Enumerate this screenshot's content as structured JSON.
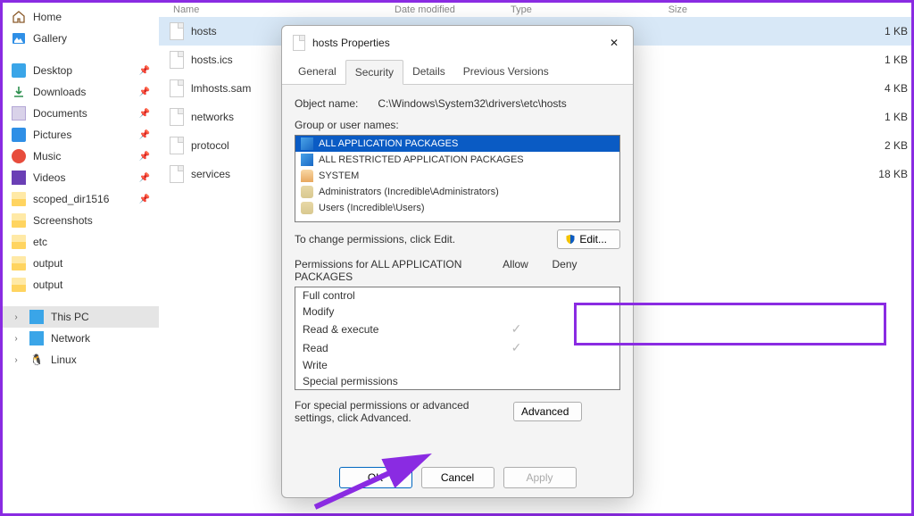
{
  "sidebar": {
    "home": "Home",
    "gallery": "Gallery",
    "quick": [
      {
        "label": "Desktop"
      },
      {
        "label": "Downloads"
      },
      {
        "label": "Documents"
      },
      {
        "label": "Pictures"
      },
      {
        "label": "Music"
      },
      {
        "label": "Videos"
      },
      {
        "label": "scoped_dir1516"
      },
      {
        "label": "Screenshots"
      },
      {
        "label": "etc"
      },
      {
        "label": "output"
      },
      {
        "label": "output"
      }
    ],
    "this_pc": "This PC",
    "network": "Network",
    "linux": "Linux"
  },
  "columns": {
    "name": "Name",
    "date": "Date modified",
    "type": "Type",
    "size": "Size"
  },
  "files": [
    {
      "name": "hosts",
      "size": "1 KB",
      "selected": true
    },
    {
      "name": "hosts.ics",
      "size": "1 KB"
    },
    {
      "name": "lmhosts.sam",
      "size": "4 KB"
    },
    {
      "name": "networks",
      "size": "1 KB"
    },
    {
      "name": "protocol",
      "size": "2 KB"
    },
    {
      "name": "services",
      "size": "18 KB"
    }
  ],
  "dialog": {
    "title": "hosts Properties",
    "tabs": [
      "General",
      "Security",
      "Details",
      "Previous Versions"
    ],
    "active_tab": "Security",
    "object_label": "Object name:",
    "object_path": "C:\\Windows\\System32\\drivers\\etc\\hosts",
    "groups_label": "Group or user names:",
    "groups": [
      {
        "label": "ALL APPLICATION PACKAGES",
        "icon": "pkg",
        "selected": true
      },
      {
        "label": "ALL RESTRICTED APPLICATION PACKAGES",
        "icon": "pkg"
      },
      {
        "label": "SYSTEM",
        "icon": "sys"
      },
      {
        "label": "Administrators (Incredible\\Administrators)",
        "icon": "users"
      },
      {
        "label": "Users (Incredible\\Users)",
        "icon": "users"
      }
    ],
    "change_text": "To change permissions, click Edit.",
    "edit_btn": "Edit...",
    "perm_for": "Permissions for ALL APPLICATION PACKAGES",
    "allow": "Allow",
    "deny": "Deny",
    "permissions": [
      {
        "label": "Full control",
        "allow": false
      },
      {
        "label": "Modify",
        "allow": false
      },
      {
        "label": "Read & execute",
        "allow": true
      },
      {
        "label": "Read",
        "allow": true
      },
      {
        "label": "Write",
        "allow": false
      },
      {
        "label": "Special permissions",
        "allow": false
      }
    ],
    "adv_text": "For special permissions or advanced settings, click Advanced.",
    "adv_btn": "Advanced",
    "ok": "OK",
    "cancel": "Cancel",
    "apply": "Apply"
  }
}
